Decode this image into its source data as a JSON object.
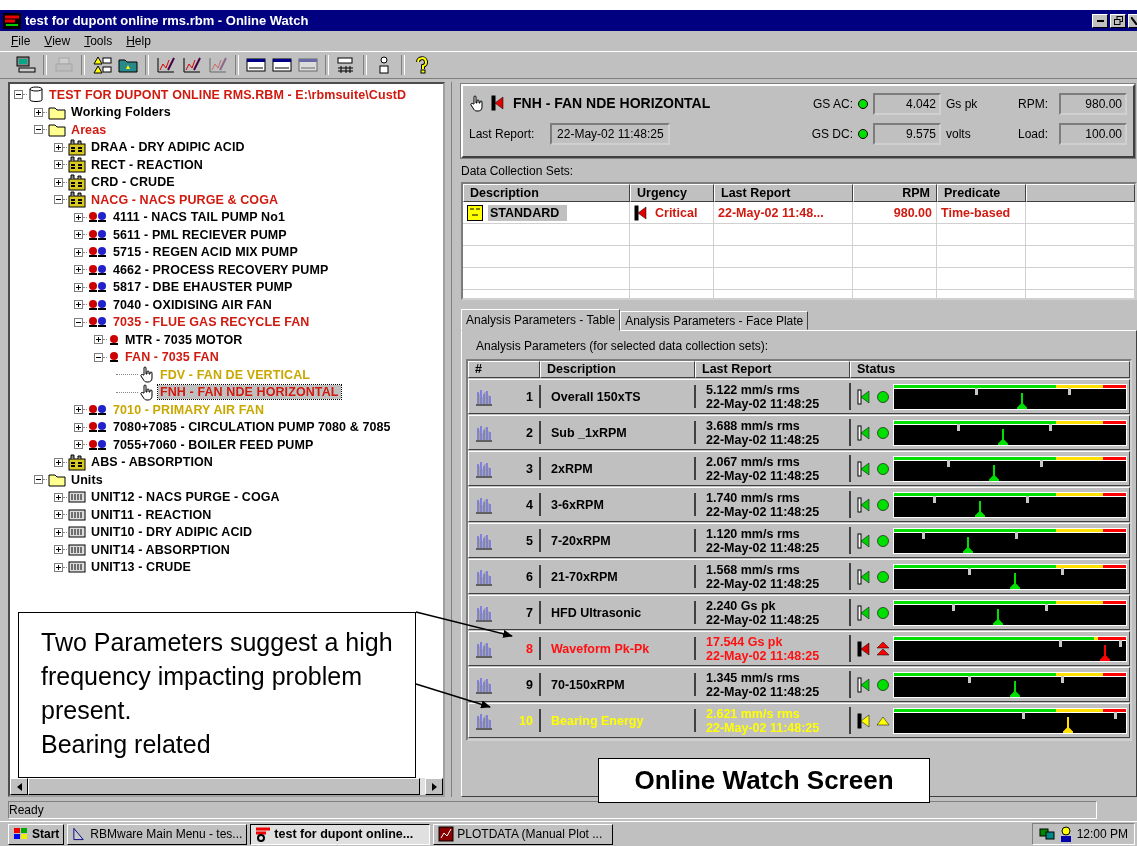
{
  "window": {
    "title": "test for dupont online rms.rbm - Online Watch"
  },
  "menu": [
    "File",
    "View",
    "Tools",
    "Help"
  ],
  "toolbar": [
    {
      "kind": "computer",
      "disabled": false
    },
    {
      "kind": "separator"
    },
    {
      "kind": "printer",
      "disabled": true
    },
    {
      "kind": "separator"
    },
    {
      "kind": "alarm-list",
      "disabled": false
    },
    {
      "kind": "folder",
      "disabled": false
    },
    {
      "kind": "separator"
    },
    {
      "kind": "pen-chart",
      "disabled": false
    },
    {
      "kind": "pen-chart",
      "disabled": false
    },
    {
      "kind": "pen-chart",
      "disabled": true
    },
    {
      "kind": "separator"
    },
    {
      "kind": "window",
      "disabled": false
    },
    {
      "kind": "window",
      "disabled": false
    },
    {
      "kind": "window",
      "disabled": true
    },
    {
      "kind": "separator"
    },
    {
      "kind": "config",
      "disabled": false
    },
    {
      "kind": "separator"
    },
    {
      "kind": "device",
      "disabled": false
    },
    {
      "kind": "separator"
    },
    {
      "kind": "help",
      "disabled": false
    }
  ],
  "tree": [
    {
      "label": "TEST FOR DUPONT ONLINE RMS.RBM - E:\\rbmsuite\\CustD",
      "kind": "database",
      "color": "#d01a10",
      "expanded": true,
      "selected": false,
      "children": [
        {
          "label": "Working Folders",
          "kind": "folder",
          "color": "#000000",
          "expanded": false,
          "selected": false
        },
        {
          "label": "Areas",
          "kind": "folder",
          "color": "#d01a10",
          "expanded": true,
          "selected": false,
          "children": [
            {
              "label": "DRAA - DRY ADIPIC ACID",
              "kind": "area",
              "color": "#000000",
              "expanded": false,
              "selected": false
            },
            {
              "label": "RECT - REACTION",
              "kind": "area",
              "color": "#000000",
              "expanded": false,
              "selected": false
            },
            {
              "label": "CRD - CRUDE",
              "kind": "area",
              "color": "#000000",
              "expanded": false,
              "selected": false
            },
            {
              "label": "NACG - NACS PURGE & COGA",
              "kind": "area",
              "color": "#d01a10",
              "expanded": true,
              "selected": false,
              "children": [
                {
                  "label": "4111 - NACS TAIL PUMP No1",
                  "kind": "machine",
                  "color": "#000000",
                  "expanded": false,
                  "selected": false
                },
                {
                  "label": "5611 - PML RECIEVER PUMP",
                  "kind": "machine",
                  "color": "#000000",
                  "expanded": false,
                  "selected": false
                },
                {
                  "label": "5715 - REGEN ACID MIX PUMP",
                  "kind": "machine",
                  "color": "#000000",
                  "expanded": false,
                  "selected": false
                },
                {
                  "label": "4662 - PROCESS RECOVERY PUMP",
                  "kind": "machine",
                  "color": "#000000",
                  "expanded": false,
                  "selected": false
                },
                {
                  "label": "5817 - DBE EHAUSTER PUMP",
                  "kind": "machine",
                  "color": "#000000",
                  "expanded": false,
                  "selected": false
                },
                {
                  "label": "7040 - OXIDISING AIR FAN",
                  "kind": "machine",
                  "color": "#000000",
                  "expanded": false,
                  "selected": false
                },
                {
                  "label": "7035 - FLUE GAS RECYCLE FAN",
                  "kind": "machine",
                  "color": "#d01a10",
                  "expanded": true,
                  "selected": false,
                  "children": [
                    {
                      "label": "MTR - 7035 MOTOR",
                      "kind": "component",
                      "color": "#000000",
                      "expanded": false,
                      "selected": false
                    },
                    {
                      "label": "FAN - 7035 FAN",
                      "kind": "component",
                      "color": "#d01a10",
                      "expanded": true,
                      "selected": false,
                      "children": [
                        {
                          "label": "FDV - FAN DE VERTICAL",
                          "kind": "point",
                          "color": "#c8a800",
                          "selected": false
                        },
                        {
                          "label": "FNH - FAN NDE HORIZONTAL",
                          "kind": "point",
                          "color": "#d01a10",
                          "selected": true
                        }
                      ]
                    }
                  ]
                },
                {
                  "label": "7010 - PRIMARY AIR FAN",
                  "kind": "machine",
                  "color": "#c8a800",
                  "expanded": false,
                  "selected": false
                },
                {
                  "label": "7080+7085 - CIRCULATION PUMP 7080 & 7085",
                  "kind": "machine",
                  "color": "#000000",
                  "expanded": false,
                  "selected": false
                },
                {
                  "label": "7055+7060 - BOILER FEED PUMP",
                  "kind": "machine",
                  "color": "#000000",
                  "expanded": false,
                  "selected": false
                }
              ]
            },
            {
              "label": "ABS - ABSORPTION",
              "kind": "area",
              "color": "#000000",
              "expanded": false,
              "selected": false
            }
          ]
        },
        {
          "label": "Units",
          "kind": "folder",
          "color": "#000000",
          "expanded": true,
          "selected": false,
          "children": [
            {
              "label": "UNIT12 - NACS PURGE - COGA",
              "kind": "unit",
              "color": "#000000",
              "expanded": false,
              "selected": false
            },
            {
              "label": "UNIT11 - REACTION",
              "kind": "unit",
              "color": "#000000",
              "expanded": false,
              "selected": false
            },
            {
              "label": "UNIT10 - DRY ADIPIC ACID",
              "kind": "unit",
              "color": "#000000",
              "expanded": false,
              "selected": false
            },
            {
              "label": "UNIT14 - ABSORPTION",
              "kind": "unit",
              "color": "#000000",
              "expanded": false,
              "selected": false
            },
            {
              "label": "UNIT13 - CRUDE",
              "kind": "unit",
              "color": "#000000",
              "expanded": false,
              "selected": false
            }
          ]
        }
      ]
    }
  ],
  "point_header": {
    "title": "FNH - FAN NDE HORIZONTAL",
    "alarm": true,
    "last_report_label": "Last Report:",
    "last_report": "22-May-02 11:48:25",
    "readings": [
      {
        "label": "GS AC:",
        "color": "#00e000",
        "value": "4.042",
        "unit": "Gs pk"
      },
      {
        "label": "GS DC:",
        "color": "#00e000",
        "value": "9.575",
        "unit": "volts"
      }
    ],
    "process": [
      {
        "label": "RPM:",
        "value": "980.00"
      },
      {
        "label": "Load:",
        "value": "100.00"
      }
    ]
  },
  "collection_sets": {
    "label": "Data Collection Sets:",
    "columns": [
      "Description",
      "Urgency",
      "Last Report",
      "RPM",
      "Predicate"
    ],
    "rows": [
      {
        "description": "STANDARD",
        "urgency": "Critical",
        "critical": true,
        "last_report": "22-May-02 11:48...",
        "rpm": "980.00",
        "predicate": "Time-based",
        "selected": true
      }
    ]
  },
  "tabs": [
    {
      "label": "Analysis Parameters - Table",
      "selected": true
    },
    {
      "label": "Analysis Parameters - Face Plate",
      "selected": false
    }
  ],
  "parameters": {
    "label": "Analysis Parameters (for selected data collection sets):",
    "columns": [
      "#",
      "Description",
      "Last Report",
      "Status"
    ],
    "rows": [
      {
        "number": "1",
        "description": "Overall 150xTS",
        "reading": "5.122 mm/s rms",
        "time": "22-May-02 11:48:25",
        "kind": "ok"
      },
      {
        "number": "2",
        "description": "Sub _1xRPM",
        "reading": "3.688 mm/s rms",
        "time": "22-May-02 11:48:25",
        "kind": "ok"
      },
      {
        "number": "3",
        "description": "2xRPM",
        "reading": "2.067 mm/s rms",
        "time": "22-May-02 11:48:25",
        "kind": "ok"
      },
      {
        "number": "4",
        "description": "3-6xRPM",
        "reading": "1.740 mm/s rms",
        "time": "22-May-02 11:48:25",
        "kind": "ok"
      },
      {
        "number": "5",
        "description": "7-20xRPM",
        "reading": "1.120 mm/s rms",
        "time": "22-May-02 11:48:25",
        "kind": "ok"
      },
      {
        "number": "6",
        "description": "21-70xRPM",
        "reading": "1.568 mm/s rms",
        "time": "22-May-02 11:48:25",
        "kind": "ok"
      },
      {
        "number": "7",
        "description": "HFD Ultrasonic",
        "reading": "2.240 Gs pk",
        "time": "22-May-02 11:48:25",
        "kind": "ok"
      },
      {
        "number": "8",
        "description": "Waveform Pk-Pk",
        "reading": "17.544 Gs pk",
        "time": "22-May-02 11:48:25",
        "kind": "alarm"
      },
      {
        "number": "9",
        "description": "70-150xRPM",
        "reading": "1.345 mm/s rms",
        "time": "22-May-02 11:48:25",
        "kind": "ok"
      },
      {
        "number": "10",
        "description": "Bearing Energy",
        "reading": "2.621 mm/s rms",
        "time": "22-May-02 11:48:25",
        "kind": "warning"
      }
    ]
  },
  "status_bar": "Ready",
  "taskbar": {
    "start": "Start",
    "tasks": [
      {
        "label": "RBMware Main Menu - tes...",
        "kind": "menu",
        "selected": false
      },
      {
        "label": "test for dupont online...",
        "kind": "watch",
        "selected": true
      },
      {
        "label": "PLOTDATA (Manual Plot ...",
        "kind": "plot",
        "selected": false
      }
    ],
    "clock": "12:00 PM"
  },
  "annotation": {
    "text": "Two Parameters suggest a high frequency impacting problem present.",
    "note": "Bearing related"
  },
  "caption": "Online Watch Screen"
}
